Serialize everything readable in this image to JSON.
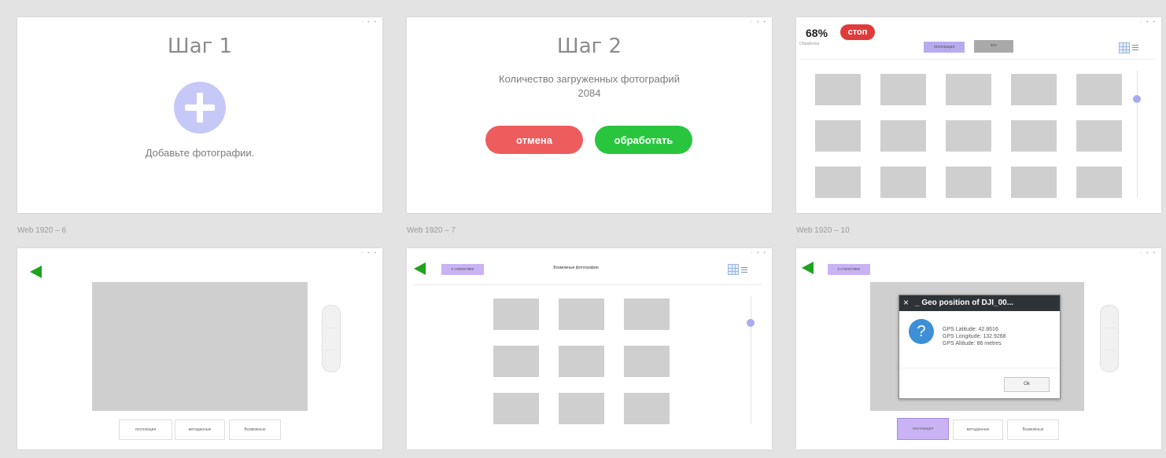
{
  "frame_controls": "- • •",
  "frame_labels": {
    "f6": "Web 1920 – 6",
    "f7": "Web 1920 – 7",
    "f10": "Web 1920 – 10"
  },
  "frame1": {
    "title": "Шаг 1",
    "hint": "Добавьте фотографии."
  },
  "frame2": {
    "title": "Шаг 2",
    "count_label": "Количество загруженных фотографий",
    "count_value": "2084",
    "cancel_label": "отмена",
    "process_label": "обработать",
    "cancel_color": "#ee5d5d",
    "process_color": "#2ac53e"
  },
  "frame3": {
    "percent": "68%",
    "stop_label": "стоп",
    "status": "Обработка",
    "progress": 0.68,
    "tab1": "геолокация",
    "tab2": "все",
    "stop_color": "#e03b3b"
  },
  "frame4": {
    "btn1": "геолокация",
    "btn2": "метаданные",
    "btn3": "Возможные"
  },
  "frame5": {
    "back_tab": "к статистике",
    "heading": "Возможные фотографии"
  },
  "frame6": {
    "back_tab": "к статистике",
    "dialog_title": "_ Geo position of DJI_00...",
    "close_glyph": "×",
    "question_glyph": "?",
    "lat": "GPS Latitude: 42.8616",
    "lon": "GPS Longitude: 132.9268",
    "alt": "GPS Altitude: 86 metres",
    "ok_label": "Ok",
    "btn1": "геолокация",
    "btn2": "метаданные",
    "btn3": "Возможные",
    "active_color": "#c9b3f4"
  },
  "icons": {
    "add": "plus-circle-icon",
    "back": "triangle-left-icon",
    "grid": "grid-view-icon",
    "list": "list-view-icon",
    "info": "question-icon"
  }
}
